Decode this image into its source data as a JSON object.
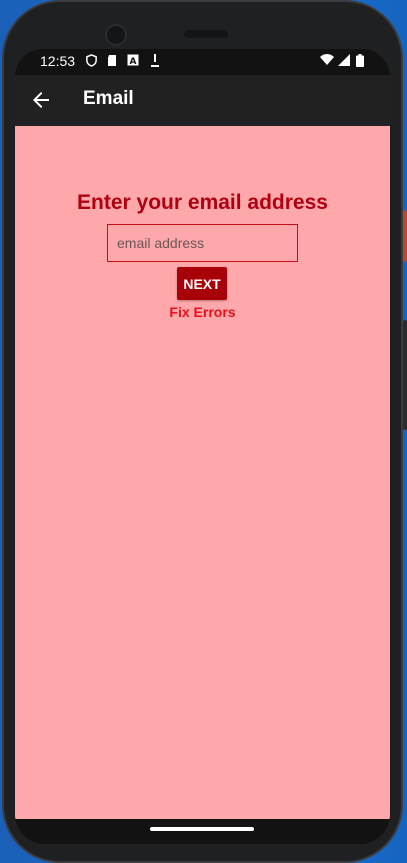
{
  "status_bar": {
    "time": "12:53",
    "icons": [
      "shield-icon",
      "sd-card-icon",
      "a-badge-icon",
      "download-icon",
      "wifi-icon",
      "signal-icon",
      "battery-icon"
    ]
  },
  "app_bar": {
    "title": "Email",
    "back_icon": "arrow-left-icon"
  },
  "form": {
    "heading": "Enter your email address",
    "email_placeholder": "email address",
    "email_value": "",
    "next_label": "NEXT",
    "error_text": "Fix Errors"
  },
  "colors": {
    "background": "#ffa8ab",
    "accent": "#a80008",
    "heading": "#b00010",
    "error": "#e8101a",
    "app_bar": "#212121"
  }
}
